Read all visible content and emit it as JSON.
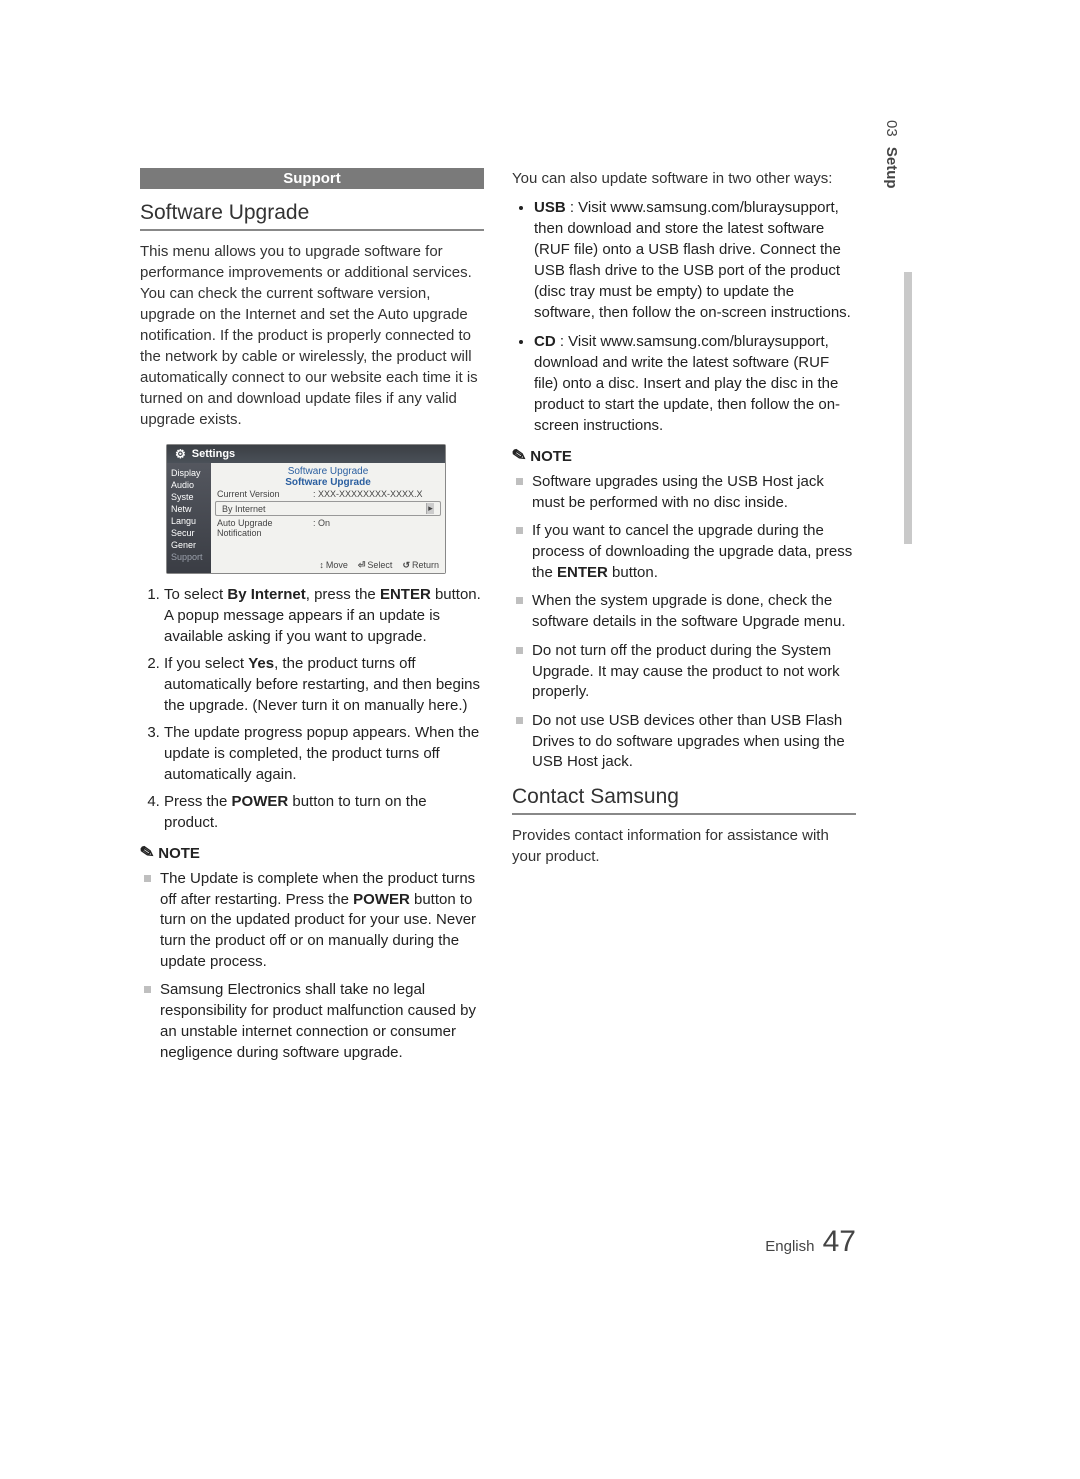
{
  "side": {
    "num": "03",
    "label": "Setup"
  },
  "section_label": "Support",
  "headings": {
    "software_upgrade": "Software Upgrade",
    "contact_samsung": "Contact Samsung"
  },
  "intro_para": "This menu allows you to upgrade software for performance improvements or additional services. You can check the current software version, upgrade on the Internet and set the Auto upgrade notification. If the product is properly connected to the network by cable or wirelessly, the product will automatically connect to our website each time it is turned on and download update files if any valid upgrade exists.",
  "tv": {
    "title": "Settings",
    "sidebar": [
      "Display",
      "Audio",
      "Syste",
      "Netw",
      "Langu",
      "Secur",
      "Gener",
      "Support"
    ],
    "sidebar_selected_index": 7,
    "panel_title1": "Software Upgrade",
    "panel_title2": "Software Upgrade",
    "rows": {
      "cur_ver_k": "Current Version",
      "cur_ver_v": ": XXX-XXXXXXXX-XXXX.X",
      "by_internet": "By Internet",
      "auto_k": "Auto Upgrade Notification",
      "auto_v": ": On"
    },
    "footer": {
      "move": "Move",
      "select": "Select",
      "return": "Return"
    }
  },
  "steps": {
    "s1a": "To select ",
    "s1b": "By Internet",
    "s1c": ", press the ",
    "s1d": "ENTER",
    "s1e": " button.",
    "s1f": "A popup message appears if an update is available asking if you want to upgrade.",
    "s2a": "If you select ",
    "s2b": "Yes",
    "s2c": ", the product turns off automatically before restarting, and then begins the upgrade. (Never turn it on manually here.)",
    "s3": "The update progress popup appears. When the update is completed, the product turns off automatically again.",
    "s4a": "Press the ",
    "s4b": "POWER",
    "s4c": " button to turn on the product."
  },
  "note_label": "NOTE",
  "notes_left": {
    "n1a": "The Update is complete when the product turns off after restarting. Press the ",
    "n1b": "POWER",
    "n1c": " button to turn on the updated product for your use. Never turn the product off or on manually during the update process.",
    "n2": "Samsung Electronics shall take no legal responsibility for product malfunction caused by an unstable internet connection or consumer negligence during software upgrade."
  },
  "right_intro": "You can also update software in two other ways:",
  "right_bullets": {
    "usb_k": "USB",
    "usb_v": " : Visit www.samsung.com/bluraysupport, then download and store the latest software (RUF file) onto a USB flash drive. Connect the USB flash drive to the USB port of the product (disc tray must be empty) to update the software, then follow the on-screen instructions.",
    "cd_k": "CD",
    "cd_v": " : Visit www.samsung.com/bluraysupport, download and write the latest software (RUF file) onto a disc. Insert and play the disc in the product to start the update, then follow the on-screen instructions."
  },
  "notes_right": {
    "n1": "Software upgrades using the USB Host jack must be performed with no disc inside.",
    "n2a": "If you want to cancel the upgrade during the process of downloading the upgrade data, press the ",
    "n2b": "ENTER",
    "n2c": " button.",
    "n3": "When the system upgrade is done, check the software details in the software Upgrade menu.",
    "n4": "Do not turn off the product during the System Upgrade. It may cause the product to not work properly.",
    "n5": "Do not use USB devices other than USB Flash Drives to do software upgrades when using the USB Host jack."
  },
  "contact_para": "Provides contact information for assistance with your product.",
  "footer": {
    "lang": "English",
    "page": "47"
  }
}
